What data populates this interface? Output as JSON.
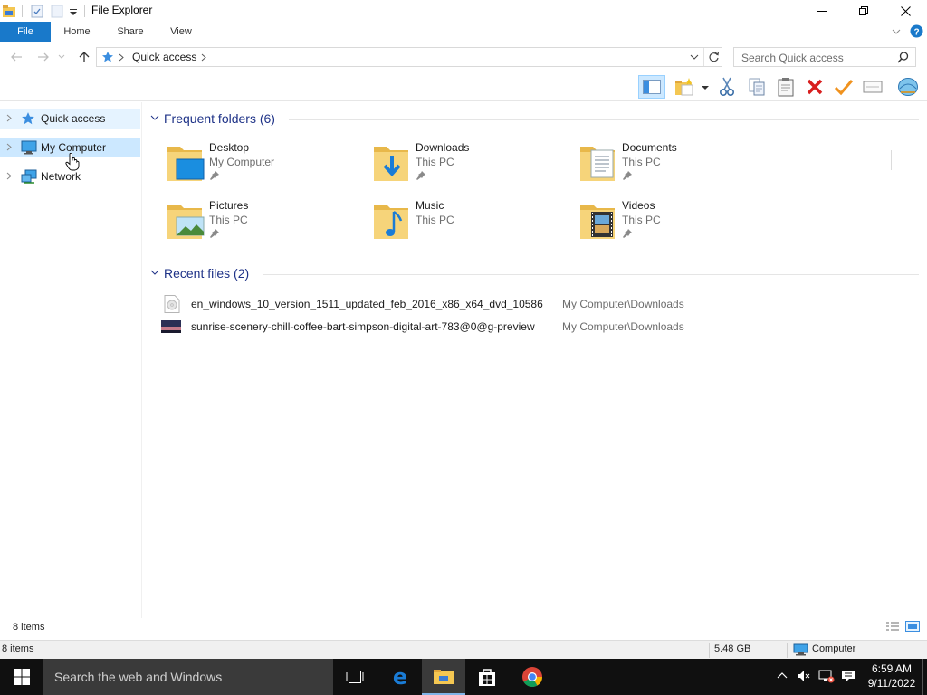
{
  "window": {
    "title": "File Explorer"
  },
  "ribbon": {
    "tabs": [
      "File",
      "Home",
      "Share",
      "View"
    ]
  },
  "address": {
    "path": "Quick access",
    "search_placeholder": "Search Quick access"
  },
  "nav": {
    "items": [
      {
        "label": "Quick access",
        "icon": "star-icon"
      },
      {
        "label": "My Computer",
        "icon": "computer-icon"
      },
      {
        "label": "Network",
        "icon": "network-icon"
      }
    ]
  },
  "content": {
    "frequent_header": "Frequent folders (6)",
    "recent_header": "Recent files (2)",
    "folders": [
      {
        "name": "Desktop",
        "location": "My Computer",
        "icon": "desktop-folder-icon"
      },
      {
        "name": "Downloads",
        "location": "This PC",
        "icon": "downloads-folder-icon"
      },
      {
        "name": "Documents",
        "location": "This PC",
        "icon": "documents-folder-icon"
      },
      {
        "name": "Pictures",
        "location": "This PC",
        "icon": "pictures-folder-icon"
      },
      {
        "name": "Music",
        "location": "This PC",
        "icon": "music-folder-icon"
      },
      {
        "name": "Videos",
        "location": "This PC",
        "icon": "videos-folder-icon"
      }
    ],
    "recent_files": [
      {
        "name": "en_windows_10_version_1511_updated_feb_2016_x86_x64_dvd_10586",
        "location": "My Computer\\Downloads",
        "icon": "disc-image-icon"
      },
      {
        "name": "sunrise-scenery-chill-coffee-bart-simpson-digital-art-783@0@g-preview",
        "location": "My Computer\\Downloads",
        "icon": "image-thumbnail-icon"
      }
    ]
  },
  "status": {
    "item_count": "8 items",
    "item_count_bottom": "8 items",
    "free_space": "5.48 GB",
    "location": "Computer"
  },
  "taskbar": {
    "search_text": "Search the web and Windows",
    "time": "6:59 AM",
    "date": "9/11/2022"
  },
  "colors": {
    "accent": "#1979ca",
    "folder": "#f4c752",
    "group_header": "#1e3287",
    "taskbar": "#101010"
  }
}
